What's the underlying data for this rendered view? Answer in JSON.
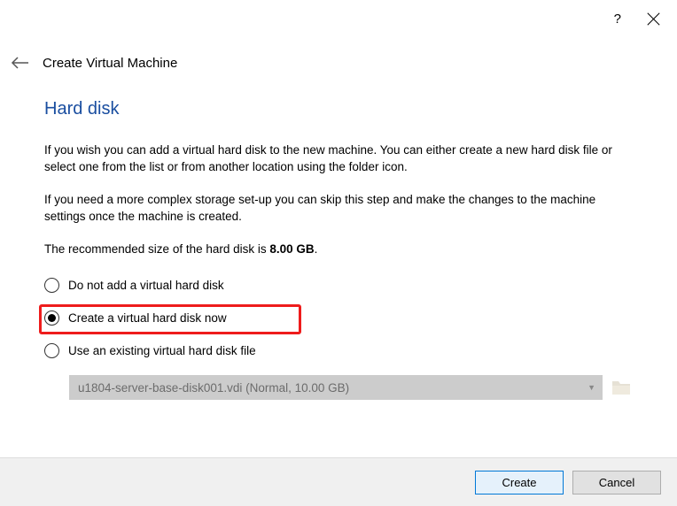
{
  "titlebar": {
    "help": "?"
  },
  "header": {
    "wizard_title": "Create Virtual Machine"
  },
  "page": {
    "title": "Hard disk",
    "para1": "If you wish you can add a virtual hard disk to the new machine. You can either create a new hard disk file or select one from the list or from another location using the folder icon.",
    "para2": "If you need a more complex storage set-up you can skip this step and make the changes to the machine settings once the machine is created.",
    "para3_prefix": "The recommended size of the hard disk is ",
    "para3_bold": "8.00 GB",
    "para3_suffix": "."
  },
  "options": {
    "opt1": "Do not add a virtual hard disk",
    "opt2": "Create a virtual hard disk now",
    "opt3": "Use an existing virtual hard disk file",
    "existing_value": "u1804-server-base-disk001.vdi (Normal, 10.00 GB)"
  },
  "footer": {
    "create": "Create",
    "cancel": "Cancel"
  }
}
